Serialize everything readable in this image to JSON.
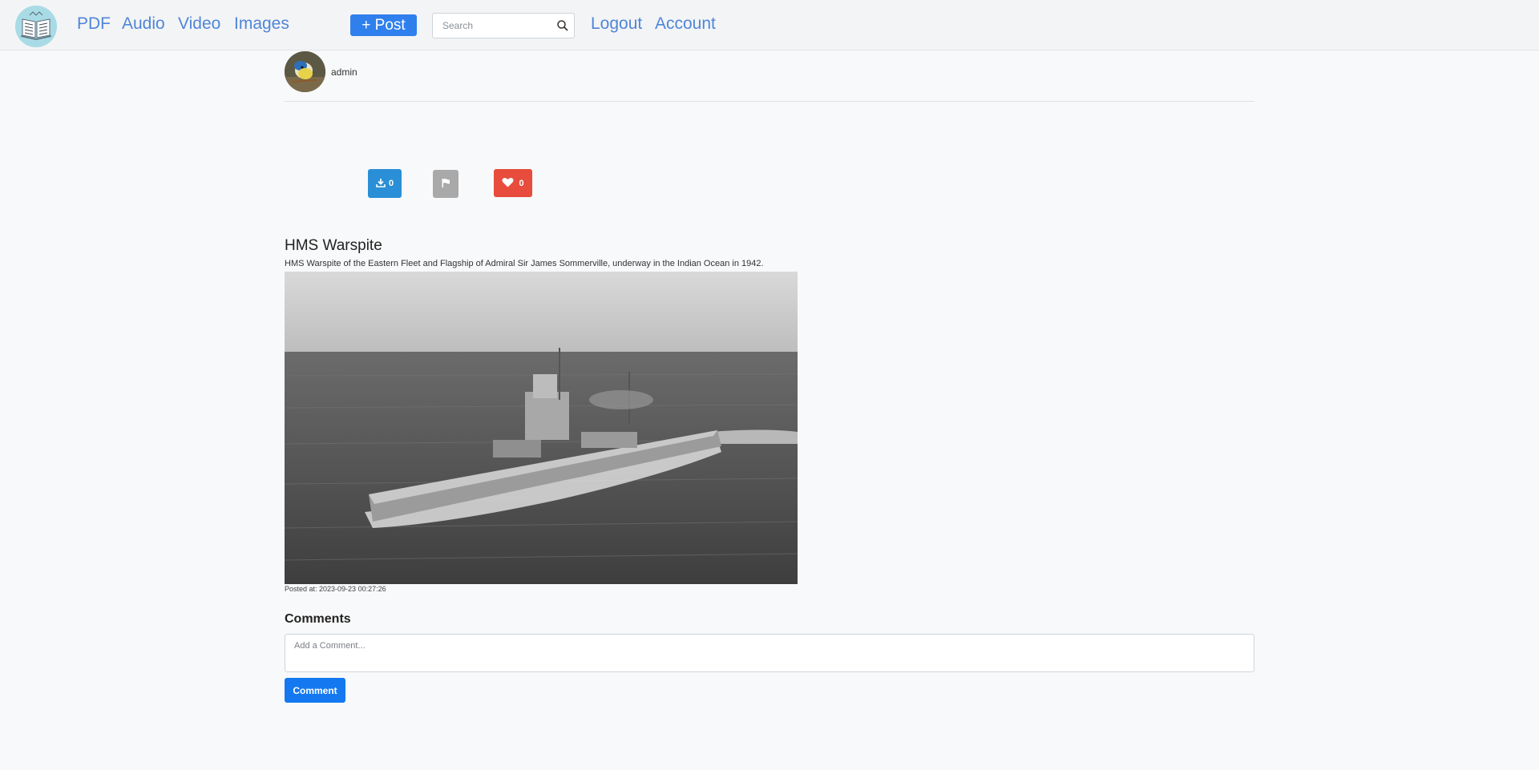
{
  "navbar": {
    "links": {
      "pdf": "PDF",
      "audio": "Audio",
      "video": "Video",
      "images": "Images",
      "logout": "Logout",
      "account": "Account"
    },
    "post_button": "+ Post",
    "search_placeholder": "Search"
  },
  "author": {
    "name": "admin"
  },
  "actions": {
    "download_count": "0",
    "like_count": "0"
  },
  "post": {
    "title": "HMS Warspite",
    "description": "HMS Warspite of the Eastern Fleet and Flagship of Admiral Sir James Sommerville, underway in the Indian Ocean in 1942.",
    "posted_at": "Posted at: 2023-09-23 00:27:26"
  },
  "comments": {
    "heading": "Comments",
    "placeholder": "Add a Comment...",
    "submit_label": "Comment"
  },
  "colors": {
    "link": "#4f86d8",
    "primary": "#2f80ed",
    "download": "#2a8fd6",
    "flag": "#a9a9a9",
    "like": "#e74c3c",
    "comment_button": "#1479f0"
  }
}
